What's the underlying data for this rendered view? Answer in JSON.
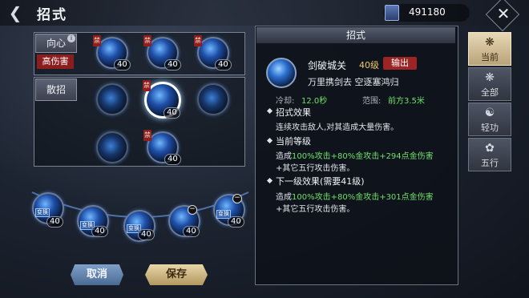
{
  "header": {
    "title": "招式",
    "currency": "491180"
  },
  "groups": [
    {
      "label": "向心",
      "badge": "高伤害"
    },
    {
      "label": "散招"
    }
  ],
  "tag_char": "禁",
  "level": "40",
  "swap_label": "变换",
  "buttons": {
    "cancel": "取消",
    "save": "保存"
  },
  "info": {
    "header": "招式",
    "name": "剑破城关",
    "level": "40级",
    "type": "输出",
    "desc": "万里携剑去 空逐塞鸿归",
    "cooldown_label": "冷却:",
    "cooldown": "12.0秒",
    "range_label": "范围:",
    "range": "前方3.5米",
    "effect_title": "招式效果",
    "effect_text": "连续攻击敌人,对其造成大量伤害。",
    "current_title": "当前等级",
    "current_a": "造成",
    "current_b": "100%攻击+80%金攻击+294点金伤害",
    "current_c": "+其它五行攻击伤害。",
    "next_title": "下一级效果(需要41级)",
    "next_a": "造成",
    "next_b": "100%攻击+80%金攻击+301点金伤害",
    "next_c": "+其它五行攻击伤害。"
  },
  "tabs": [
    {
      "label": "当前"
    },
    {
      "label": "全部"
    },
    {
      "label": "轻功"
    },
    {
      "label": "五行"
    }
  ]
}
